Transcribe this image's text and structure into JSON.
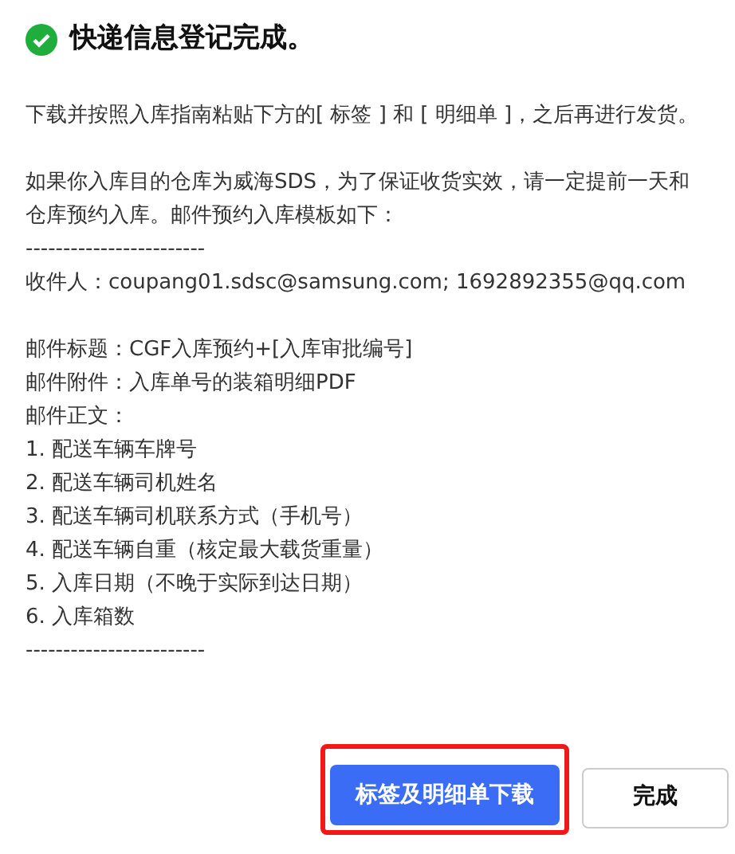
{
  "title": "快递信息登记完成。",
  "blocks": [
    {
      "lines": [
        "下载并按照入库指南粘贴下方的[ 标签 ] 和 [ 明细单 ]，之后再进行发货。"
      ]
    },
    {
      "lines": [
        "如果你入库目的仓库为威海SDS，为了保证收货实效，请一定提前一天和仓库预约入库。邮件预约入库模板如下：",
        "------------------------",
        "收件人：coupang01.sdsc@samsung.com; 1692892355@qq.com"
      ]
    },
    {
      "lines": [
        "邮件标题：CGF入库预约+[入库审批编号]",
        "邮件附件：入库单号的装箱明细PDF",
        "邮件正文：",
        "1. 配送车辆车牌号",
        "2. 配送车辆司机姓名",
        "3. 配送车辆司机联系方式（手机号）",
        "4. 配送车辆自重（核定最大载货重量）",
        "5. 入库日期（不晚于实际到达日期）",
        "6. 入库箱数",
        "------------------------"
      ]
    }
  ],
  "buttons": [
    {
      "label": "标签及明细单下载",
      "kind": "primary",
      "highlighted": true
    },
    {
      "label": "完成",
      "kind": "secondary",
      "highlighted": false
    }
  ]
}
